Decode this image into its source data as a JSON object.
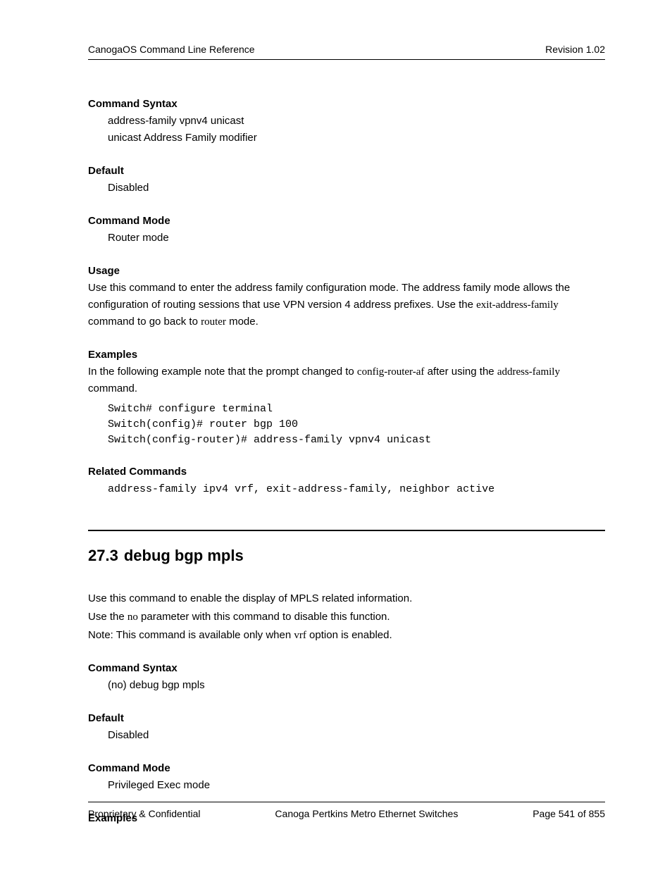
{
  "header": {
    "left": "CanogaOS Command Line Reference",
    "right": "Revision 1.02"
  },
  "sec1": {
    "commandSyntax": {
      "heading": "Command Syntax",
      "line1": "address-family vpnv4 unicast",
      "line2": "unicast Address Family modifier"
    },
    "default": {
      "heading": "Default",
      "value": "Disabled"
    },
    "commandMode": {
      "heading": "Command Mode",
      "value": "Router mode"
    },
    "usage": {
      "heading": "Usage",
      "pre1": "Use this command to enter the address family configuration mode. The address family mode allows the configuration of routing sessions that use VPN version 4 address prefixes. Use the ",
      "cmd1": "exit-address-family",
      "mid1": " command to go back to ",
      "cmd2": "router",
      "post1": " mode."
    },
    "examples": {
      "heading": "Examples",
      "pre1": "In the following example note that the prompt changed to ",
      "tok1": "config-router-af",
      "mid1": " after using the ",
      "tok2": "address-family",
      "post1": " command.",
      "code": "Switch# configure terminal\nSwitch(config)# router bgp 100\nSwitch(config-router)# address-family vpnv4 unicast"
    },
    "related": {
      "heading": "Related Commands",
      "code": "address-family ipv4 vrf, exit-address-family, neighbor active"
    }
  },
  "sec2": {
    "number": "27.3",
    "title": "debug bgp mpls",
    "intro": {
      "line1": "Use this command to enable the display of MPLS related information.",
      "line2a": "Use the ",
      "line2tok": "no",
      "line2b": " parameter with this command to disable this function.",
      "line3a": "Note: This command is available only when ",
      "line3tok": "vrf",
      "line3b": " option is enabled."
    },
    "commandSyntax": {
      "heading": "Command Syntax",
      "value": "(no) debug bgp mpls"
    },
    "default": {
      "heading": "Default",
      "value": "Disabled"
    },
    "commandMode": {
      "heading": "Command Mode",
      "value": "Privileged Exec mode"
    },
    "examples": {
      "heading": "Examples"
    }
  },
  "footer": {
    "left": "Proprietary & Confidential",
    "center": "Canoga Pertkins Metro Ethernet Switches",
    "right": "Page 541 of 855"
  }
}
